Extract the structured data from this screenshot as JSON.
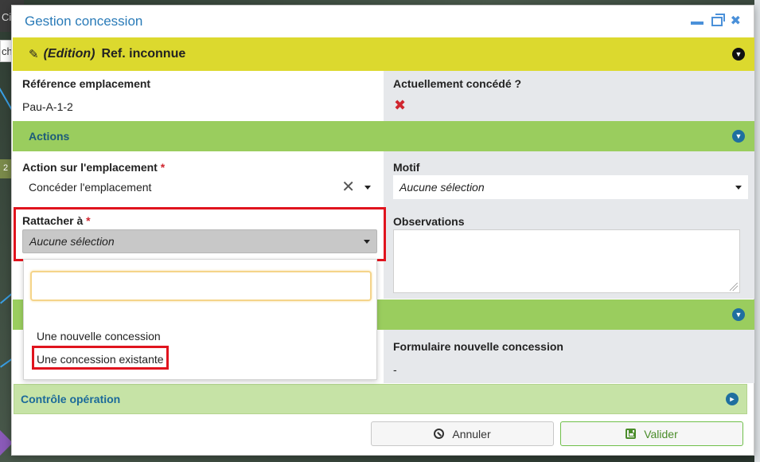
{
  "background": {
    "topbar_text": "Ci",
    "input_text": "ch",
    "badge_text": "2"
  },
  "modal": {
    "title": "Gestion concession",
    "controls": {
      "minimize": "minimize-icon",
      "restore": "restore-icon",
      "close": "close-icon"
    }
  },
  "header_band": {
    "edition_label": "(Edition)",
    "reference": "Ref. inconnue"
  },
  "info": {
    "ref_label": "Référence emplacement",
    "ref_value": "Pau-A-1-2",
    "concede_label": "Actuellement concédé ?",
    "concede_value_icon": "red-x-icon"
  },
  "actions_section": {
    "title": "Actions",
    "action_label": "Action sur l'emplacement",
    "required_mark": "*",
    "action_value": "Concéder l'emplacement",
    "motif_label": "Motif",
    "motif_value": "Aucune sélection",
    "rattacher_label": "Rattacher à",
    "rattacher_value": "Aucune sélection",
    "observations_label": "Observations"
  },
  "dropdown": {
    "search_placeholder": "",
    "options": [
      "Une nouvelle concession",
      "Une concession existante"
    ]
  },
  "nouvelle_section": {
    "form_label": "Formulaire nouvelle concession",
    "form_value": "-"
  },
  "controle_section": {
    "title": "Contrôle opération"
  },
  "footer": {
    "cancel_label": "Annuler",
    "ok_label": "Valider"
  },
  "colors": {
    "yellow_band": "#dcd92e",
    "green_band": "#9acd5e",
    "light_green_band": "#c6e3a6",
    "highlight": "#e0141e",
    "title_blue": "#2a7bb8"
  }
}
